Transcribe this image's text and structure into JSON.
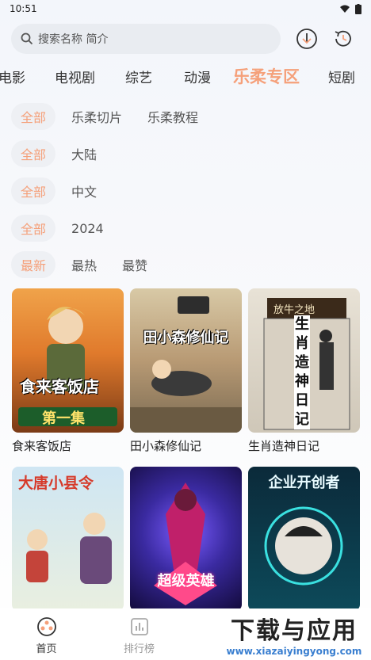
{
  "status": {
    "time": "10:51"
  },
  "search": {
    "placeholder": "搜索名称 简介"
  },
  "icons": {
    "search": "search-icon",
    "download": "download-icon",
    "history": "history-icon"
  },
  "categories": [
    {
      "label": "电影"
    },
    {
      "label": "电视剧"
    },
    {
      "label": "综艺"
    },
    {
      "label": "动漫"
    },
    {
      "label": "乐柔专区"
    },
    {
      "label": "短剧"
    }
  ],
  "filters": {
    "type": [
      "全部",
      "乐柔切片",
      "乐柔教程"
    ],
    "region": [
      "全部",
      "大陆"
    ],
    "language": [
      "全部",
      "中文"
    ],
    "year": [
      "全部",
      "2024"
    ],
    "sort": [
      "最新",
      "最热",
      "最赞"
    ]
  },
  "cards": [
    {
      "title": "食来客饭店",
      "poster_text": "食来客饭店",
      "poster_sub": "第一集"
    },
    {
      "title": "田小森修仙记",
      "poster_text": "田小森修仙记"
    },
    {
      "title": "生肖造神日记",
      "poster_text": "生肖造神日记",
      "poster_sub": "放牛之地"
    },
    {
      "title": "",
      "poster_text": "大唐小县令"
    },
    {
      "title": "",
      "poster_text": "超级英雄"
    },
    {
      "title": "",
      "poster_text": "企业开创者"
    }
  ],
  "nav": [
    {
      "label": "首页",
      "icon": "home-icon"
    },
    {
      "label": "排行榜",
      "icon": "chart-icon"
    }
  ],
  "watermark": {
    "main": "下载与应用",
    "url": "www.xiazaiyingyong.com"
  },
  "colors": {
    "accent": "#f5a07a",
    "chip_bg": "#eef0f4"
  }
}
